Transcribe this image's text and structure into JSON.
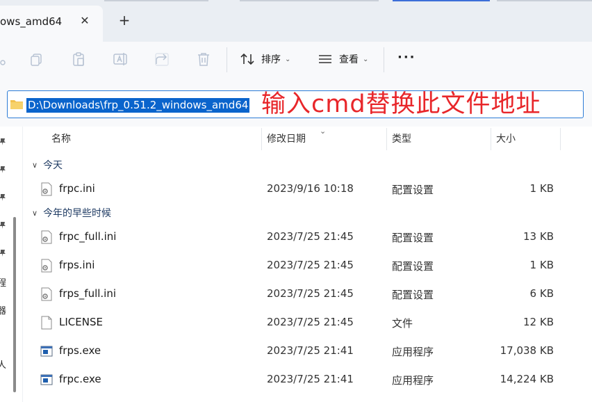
{
  "tab": {
    "title": "ows_amd64"
  },
  "toolbar": {
    "sort_label": "排序",
    "view_label": "查看",
    "more_label": "···"
  },
  "address": {
    "path": "D:\\Downloads\\frp_0.51.2_windows_amd64",
    "annotation": "输入cmd替换此文件地址"
  },
  "nav": {
    "fragments": [
      "程",
      "器",
      "人"
    ]
  },
  "columns": {
    "name": "名称",
    "date": "修改日期",
    "type": "类型",
    "size": "大小"
  },
  "groups": [
    {
      "label": "今天",
      "files": [
        {
          "name": "frpc.ini",
          "date": "2023/9/16 10:18",
          "type": "配置设置",
          "size": "1 KB",
          "icon": "config-file-icon"
        }
      ]
    },
    {
      "label": "今年的早些时候",
      "files": [
        {
          "name": "frpc_full.ini",
          "date": "2023/7/25 21:45",
          "type": "配置设置",
          "size": "13 KB",
          "icon": "config-file-icon"
        },
        {
          "name": "frps.ini",
          "date": "2023/7/25 21:45",
          "type": "配置设置",
          "size": "1 KB",
          "icon": "config-file-icon"
        },
        {
          "name": "frps_full.ini",
          "date": "2023/7/25 21:45",
          "type": "配置设置",
          "size": "6 KB",
          "icon": "config-file-icon"
        },
        {
          "name": "LICENSE",
          "date": "2023/7/25 21:45",
          "type": "文件",
          "size": "12 KB",
          "icon": "blank-file-icon"
        },
        {
          "name": "frps.exe",
          "date": "2023/7/25 21:41",
          "type": "应用程序",
          "size": "17,038 KB",
          "icon": "exe-file-icon"
        },
        {
          "name": "frpc.exe",
          "date": "2023/7/25 21:41",
          "type": "应用程序",
          "size": "14,224 KB",
          "icon": "exe-file-icon"
        }
      ]
    }
  ],
  "colors": {
    "accent": "#0a64cc",
    "annotation": "#e8262a",
    "group_text": "#1f3b63"
  }
}
